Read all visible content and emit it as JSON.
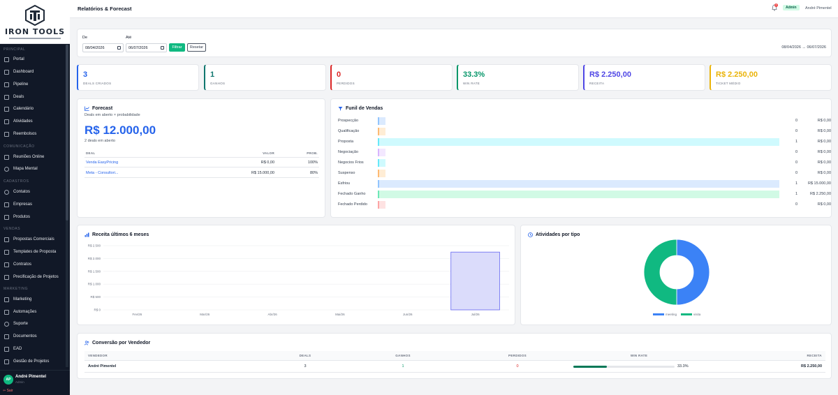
{
  "brand": {
    "name": "IRON TOOLS"
  },
  "sidebar": {
    "sections": [
      "PRINCIPAL",
      "COMUNICAÇÃO",
      "CADASTROS",
      "VENDAS",
      "MARKETING"
    ],
    "items": [
      {
        "label": "Portal",
        "icon": "home-icon"
      },
      {
        "label": "Dashboard",
        "icon": "dashboard-icon"
      },
      {
        "label": "Pipeline",
        "icon": "pipeline-icon"
      },
      {
        "label": "Deals",
        "icon": "deals-icon"
      },
      {
        "label": "Calendário",
        "icon": "calendar-icon"
      },
      {
        "label": "Atividades",
        "icon": "activities-icon"
      },
      {
        "label": "Reembolsos",
        "icon": "refund-icon"
      },
      {
        "label": "Reuniões Online",
        "icon": "video-icon"
      },
      {
        "label": "Mapa Mental",
        "icon": "mindmap-icon"
      },
      {
        "label": "Contatos",
        "icon": "contacts-icon"
      },
      {
        "label": "Empresas",
        "icon": "building-icon"
      },
      {
        "label": "Produtos",
        "icon": "box-icon"
      },
      {
        "label": "Propostas Comerciais",
        "icon": "proposal-icon"
      },
      {
        "label": "Templates de Proposta",
        "icon": "template-icon"
      },
      {
        "label": "Contratos",
        "icon": "contract-icon"
      },
      {
        "label": "Precificação de Projetos",
        "icon": "pricing-icon"
      },
      {
        "label": "Marketing",
        "icon": "megaphone-icon"
      },
      {
        "label": "Automações",
        "icon": "bolt-icon"
      },
      {
        "label": "Suporte",
        "icon": "support-icon"
      },
      {
        "label": "Documentos",
        "icon": "document-icon"
      },
      {
        "label": "EAD",
        "icon": "education-icon"
      },
      {
        "label": "Gestão de Projetos",
        "icon": "projects-icon"
      }
    ],
    "user": {
      "initials": "AP",
      "name": "André Pimentel",
      "role": "Admin",
      "logout": "Sair"
    }
  },
  "header": {
    "title": "Relatórios & Forecast",
    "notifications": "4",
    "role_badge": "Admin",
    "user": "André Pimentel"
  },
  "filter": {
    "from_label": "De",
    "from_value": "08/04/2026",
    "to_label": "Até",
    "to_value": "06/07/2026",
    "apply": "Filtrar",
    "reset": "Resetar",
    "range_text": "08/04/2026 → 06/07/2026"
  },
  "kpis": [
    {
      "value": "3",
      "label": "DEALS CRIADOS",
      "color": "#2563eb"
    },
    {
      "value": "1",
      "label": "GANHOS",
      "color": "#0f766e"
    },
    {
      "value": "0",
      "label": "PERDIDOS",
      "color": "#dc2626"
    },
    {
      "value": "33.3%",
      "label": "WIN RATE",
      "color": "#059669"
    },
    {
      "value": "R$ 2.250,00",
      "label": "RECEITA",
      "color": "#4f46e5"
    },
    {
      "value": "R$ 2.250,00",
      "label": "TICKET MÉDIO",
      "color": "#eab308"
    }
  ],
  "forecast": {
    "title": "Forecast",
    "subtitle": "Deals em aberto × probabilidade",
    "total": "R$ 12.000,00",
    "count_text": "2 deals em aberto",
    "columns": [
      "DEAL",
      "VALOR",
      "PROB."
    ],
    "rows": [
      {
        "deal": "Venda EasyPricing",
        "value": "R$ 0,00",
        "prob": "100%"
      },
      {
        "deal": "Meta - Consultori...",
        "value": "R$ 15.000,00",
        "prob": "80%"
      }
    ]
  },
  "funnel": {
    "title": "Funil de Vendas",
    "stages": [
      {
        "label": "Prospecção",
        "count": "0",
        "value": "R$ 0,00",
        "color": "#dbeafe",
        "border": "#93c5fd",
        "full": false
      },
      {
        "label": "Qualificação",
        "count": "0",
        "value": "R$ 0,00",
        "color": "#ffedd5",
        "border": "#fdba74",
        "full": false
      },
      {
        "label": "Proposta",
        "count": "1",
        "value": "R$ 0,00",
        "color": "#cffafe",
        "border": "#67e8f9",
        "full": true
      },
      {
        "label": "Negociação",
        "count": "0",
        "value": "R$ 0,00",
        "color": "#f3e8ff",
        "border": "#d8b4fe",
        "full": false
      },
      {
        "label": "Negocios Frios",
        "count": "0",
        "value": "R$ 0,00",
        "color": "#cffafe",
        "border": "#67e8f9",
        "full": false
      },
      {
        "label": "Suspenso",
        "count": "0",
        "value": "R$ 0,00",
        "color": "#ffedd5",
        "border": "#fdba74",
        "full": false
      },
      {
        "label": "Esfriou",
        "count": "1",
        "value": "R$ 15.000,00",
        "color": "#dbeafe",
        "border": "#93c5fd",
        "full": true
      },
      {
        "label": "Fechado Ganho",
        "count": "1",
        "value": "R$ 2.250,00",
        "color": "#d1fae5",
        "border": "#6ee7b7",
        "full": true
      },
      {
        "label": "Fechado Perdido",
        "count": "0",
        "value": "R$ 0,00",
        "color": "#fee2e2",
        "border": "#fca5a5",
        "full": false
      }
    ]
  },
  "revenue_chart_title": "Receita últimos 6 meses",
  "activities_chart_title": "Atividades por tipo",
  "chart_data": [
    {
      "type": "bar",
      "categories": [
        "Fev/26",
        "Mar/26",
        "Abr/26",
        "Mai/26",
        "Jun/26",
        "Jul/26"
      ],
      "values": [
        0,
        0,
        0,
        0,
        0,
        2250
      ],
      "ytick_labels": [
        "R$ 0",
        "R$ 500",
        "R$ 1.000",
        "R$ 1.500",
        "R$ 2.000",
        "R$ 2.500"
      ],
      "ylim": [
        0,
        2500
      ],
      "grid": true,
      "colors": {
        "fill": "#dbdcfb",
        "stroke": "#6366f1"
      }
    },
    {
      "type": "pie",
      "donut": true,
      "labels": [
        "meeting",
        "visita"
      ],
      "values": [
        1,
        1
      ],
      "colors": [
        "#3b82f6",
        "#10b981"
      ],
      "legend": "bottom"
    }
  ],
  "conversion": {
    "title": "Conversão por Vendedor",
    "columns": [
      "VENDEDOR",
      "DEALS",
      "GANHOS",
      "PERDIDOS",
      "WIN RATE",
      "RECEITA"
    ],
    "rows": [
      {
        "seller": "André Pimentel",
        "deals": "3",
        "wins": "1",
        "losses": "0",
        "win_rate": "33.3%",
        "win_rate_value": 0.333,
        "revenue": "R$ 2.250,00"
      }
    ]
  }
}
